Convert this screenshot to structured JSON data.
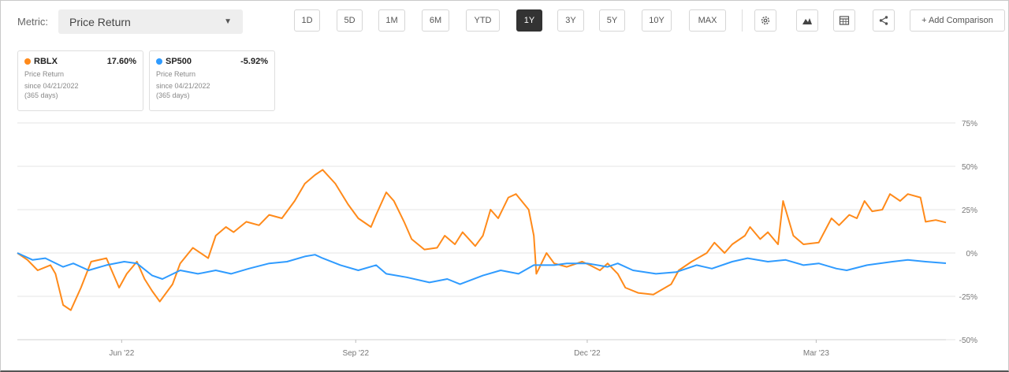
{
  "toolbar": {
    "metric_label": "Metric:",
    "metric_value": "Price Return",
    "periods": [
      "1D",
      "5D",
      "1M",
      "6M",
      "YTD",
      "1Y",
      "3Y",
      "5Y",
      "10Y",
      "MAX"
    ],
    "active_period": "1Y",
    "add_comparison": "+ Add Comparison"
  },
  "cards": [
    {
      "ticker": "RBLX",
      "value": "17.60%",
      "metric": "Price Return",
      "since": "since 04/21/2022",
      "days": "(365 days)",
      "color": "#ff8a1a"
    },
    {
      "ticker": "SP500",
      "value": "-5.92%",
      "metric": "Price Return",
      "since": "since 04/21/2022",
      "days": "(365 days)",
      "color": "#2f9bff"
    }
  ],
  "chart_data": {
    "type": "line",
    "title": "",
    "xlabel": "",
    "ylabel": "",
    "ylim": [
      -50,
      75
    ],
    "y_ticks": [
      "75%",
      "50%",
      "25%",
      "0%",
      "-25%",
      "-50%"
    ],
    "y_tick_values": [
      75,
      50,
      25,
      0,
      -25,
      -50
    ],
    "x_tick_labels": [
      "Jun '22",
      "Sep '22",
      "Dec '22",
      "Mar '23"
    ],
    "x_tick_dates": [
      "2022-06-01",
      "2022-09-01",
      "2022-12-01",
      "2023-03-01"
    ],
    "x_range": [
      "2022-04-21",
      "2023-04-21"
    ],
    "grid": true,
    "series": [
      {
        "name": "RBLX",
        "color": "#ff8a1a",
        "points": [
          [
            "2022-04-21",
            0
          ],
          [
            "2022-04-25",
            -4
          ],
          [
            "2022-04-29",
            -10
          ],
          [
            "2022-05-04",
            -7
          ],
          [
            "2022-05-06",
            -12
          ],
          [
            "2022-05-09",
            -30
          ],
          [
            "2022-05-12",
            -33
          ],
          [
            "2022-05-16",
            -20
          ],
          [
            "2022-05-20",
            -5
          ],
          [
            "2022-05-26",
            -3
          ],
          [
            "2022-05-31",
            -20
          ],
          [
            "2022-06-03",
            -12
          ],
          [
            "2022-06-07",
            -5
          ],
          [
            "2022-06-10",
            -15
          ],
          [
            "2022-06-13",
            -22
          ],
          [
            "2022-06-16",
            -28
          ],
          [
            "2022-06-21",
            -18
          ],
          [
            "2022-06-24",
            -6
          ],
          [
            "2022-06-29",
            3
          ],
          [
            "2022-07-05",
            -3
          ],
          [
            "2022-07-08",
            10
          ],
          [
            "2022-07-12",
            15
          ],
          [
            "2022-07-15",
            12
          ],
          [
            "2022-07-20",
            18
          ],
          [
            "2022-07-25",
            16
          ],
          [
            "2022-07-29",
            22
          ],
          [
            "2022-08-03",
            20
          ],
          [
            "2022-08-08",
            30
          ],
          [
            "2022-08-12",
            40
          ],
          [
            "2022-08-16",
            45
          ],
          [
            "2022-08-19",
            48
          ],
          [
            "2022-08-24",
            40
          ],
          [
            "2022-08-29",
            28
          ],
          [
            "2022-09-02",
            20
          ],
          [
            "2022-09-07",
            15
          ],
          [
            "2022-09-09",
            22
          ],
          [
            "2022-09-13",
            35
          ],
          [
            "2022-09-16",
            30
          ],
          [
            "2022-09-20",
            18
          ],
          [
            "2022-09-23",
            8
          ],
          [
            "2022-09-28",
            2
          ],
          [
            "2022-10-03",
            3
          ],
          [
            "2022-10-06",
            10
          ],
          [
            "2022-10-10",
            5
          ],
          [
            "2022-10-13",
            12
          ],
          [
            "2022-10-18",
            4
          ],
          [
            "2022-10-21",
            10
          ],
          [
            "2022-10-24",
            25
          ],
          [
            "2022-10-27",
            20
          ],
          [
            "2022-10-31",
            32
          ],
          [
            "2022-11-03",
            34
          ],
          [
            "2022-11-08",
            25
          ],
          [
            "2022-11-10",
            10
          ],
          [
            "2022-11-11",
            -12
          ],
          [
            "2022-11-15",
            0
          ],
          [
            "2022-11-18",
            -6
          ],
          [
            "2022-11-23",
            -8
          ],
          [
            "2022-11-29",
            -5
          ],
          [
            "2022-12-02",
            -7
          ],
          [
            "2022-12-06",
            -10
          ],
          [
            "2022-12-09",
            -6
          ],
          [
            "2022-12-13",
            -12
          ],
          [
            "2022-12-16",
            -20
          ],
          [
            "2022-12-21",
            -23
          ],
          [
            "2022-12-27",
            -24
          ],
          [
            "2023-01-03",
            -18
          ],
          [
            "2023-01-06",
            -10
          ],
          [
            "2023-01-11",
            -5
          ],
          [
            "2023-01-17",
            0
          ],
          [
            "2023-01-20",
            6
          ],
          [
            "2023-01-24",
            0
          ],
          [
            "2023-01-27",
            5
          ],
          [
            "2023-02-01",
            10
          ],
          [
            "2023-02-03",
            15
          ],
          [
            "2023-02-07",
            8
          ],
          [
            "2023-02-10",
            12
          ],
          [
            "2023-02-14",
            5
          ],
          [
            "2023-02-16",
            30
          ],
          [
            "2023-02-20",
            10
          ],
          [
            "2023-02-24",
            5
          ],
          [
            "2023-03-02",
            6
          ],
          [
            "2023-03-07",
            20
          ],
          [
            "2023-03-10",
            16
          ],
          [
            "2023-03-14",
            22
          ],
          [
            "2023-03-17",
            20
          ],
          [
            "2023-03-20",
            30
          ],
          [
            "2023-03-23",
            24
          ],
          [
            "2023-03-27",
            25
          ],
          [
            "2023-03-30",
            34
          ],
          [
            "2023-04-03",
            30
          ],
          [
            "2023-04-06",
            34
          ],
          [
            "2023-04-11",
            32
          ],
          [
            "2023-04-13",
            18
          ],
          [
            "2023-04-17",
            19
          ],
          [
            "2023-04-21",
            17.6
          ]
        ]
      },
      {
        "name": "SP500",
        "color": "#2f9bff",
        "points": [
          [
            "2022-04-21",
            0
          ],
          [
            "2022-04-27",
            -4
          ],
          [
            "2022-05-02",
            -3
          ],
          [
            "2022-05-09",
            -8
          ],
          [
            "2022-05-13",
            -6
          ],
          [
            "2022-05-19",
            -10
          ],
          [
            "2022-05-26",
            -7
          ],
          [
            "2022-06-02",
            -5
          ],
          [
            "2022-06-07",
            -6
          ],
          [
            "2022-06-13",
            -13
          ],
          [
            "2022-06-17",
            -15
          ],
          [
            "2022-06-24",
            -10
          ],
          [
            "2022-07-01",
            -12
          ],
          [
            "2022-07-08",
            -10
          ],
          [
            "2022-07-14",
            -12
          ],
          [
            "2022-07-21",
            -9
          ],
          [
            "2022-07-29",
            -6
          ],
          [
            "2022-08-05",
            -5
          ],
          [
            "2022-08-12",
            -2
          ],
          [
            "2022-08-16",
            -1
          ],
          [
            "2022-08-19",
            -3
          ],
          [
            "2022-08-26",
            -7
          ],
          [
            "2022-09-02",
            -10
          ],
          [
            "2022-09-09",
            -7
          ],
          [
            "2022-09-13",
            -12
          ],
          [
            "2022-09-21",
            -14
          ],
          [
            "2022-09-30",
            -17
          ],
          [
            "2022-10-07",
            -15
          ],
          [
            "2022-10-12",
            -18
          ],
          [
            "2022-10-21",
            -13
          ],
          [
            "2022-10-28",
            -10
          ],
          [
            "2022-11-04",
            -12
          ],
          [
            "2022-11-10",
            -7
          ],
          [
            "2022-11-18",
            -7
          ],
          [
            "2022-11-23",
            -6
          ],
          [
            "2022-12-01",
            -6
          ],
          [
            "2022-12-09",
            -8
          ],
          [
            "2022-12-13",
            -6
          ],
          [
            "2022-12-19",
            -10
          ],
          [
            "2022-12-28",
            -12
          ],
          [
            "2023-01-05",
            -11
          ],
          [
            "2023-01-13",
            -7
          ],
          [
            "2023-01-19",
            -9
          ],
          [
            "2023-01-27",
            -5
          ],
          [
            "2023-02-02",
            -3
          ],
          [
            "2023-02-10",
            -5
          ],
          [
            "2023-02-17",
            -4
          ],
          [
            "2023-02-24",
            -7
          ],
          [
            "2023-03-02",
            -6
          ],
          [
            "2023-03-09",
            -9
          ],
          [
            "2023-03-13",
            -10
          ],
          [
            "2023-03-21",
            -7
          ],
          [
            "2023-03-31",
            -5
          ],
          [
            "2023-04-06",
            -4
          ],
          [
            "2023-04-13",
            -5
          ],
          [
            "2023-04-21",
            -5.92
          ]
        ]
      }
    ]
  }
}
